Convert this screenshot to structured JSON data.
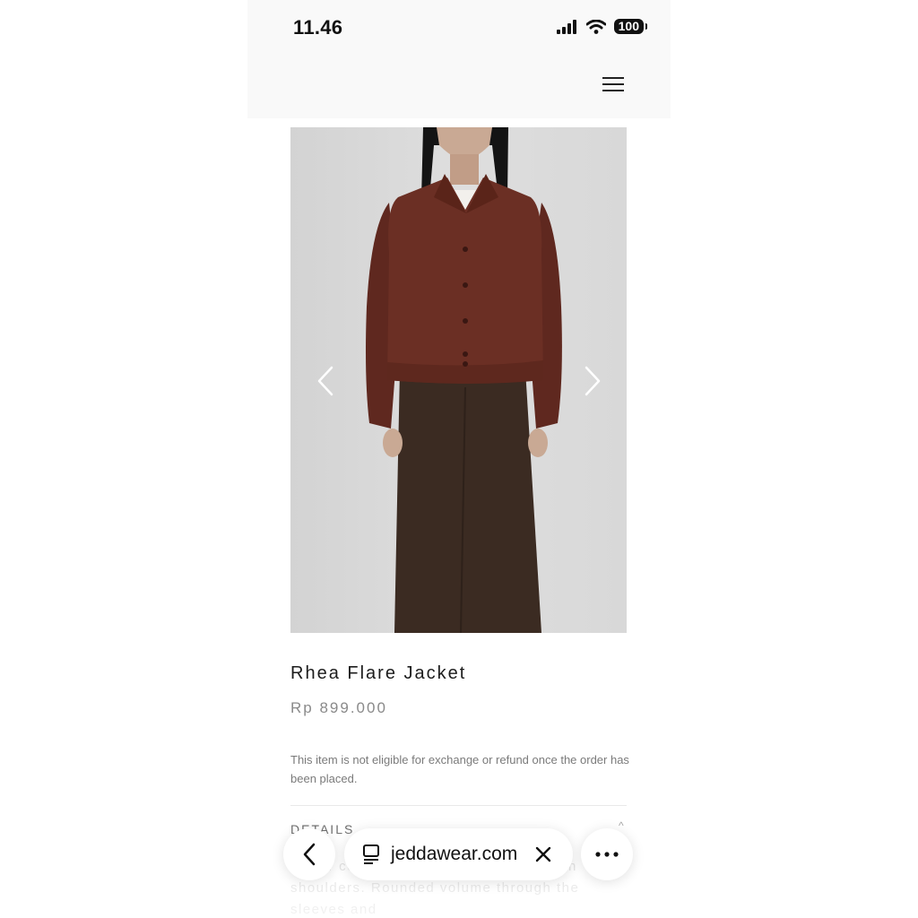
{
  "status_bar": {
    "time": "11.46",
    "battery": "100"
  },
  "product": {
    "title": "Rhea Flare Jacket",
    "price": "Rp 899.000",
    "policy_note": "This item is not eligible for exchange or refund once the order has been placed."
  },
  "details": {
    "heading": "DETAILS",
    "toggle_glyph": "^",
    "text": "…d … construction and softened raglan shoulders. Rounded volume through the sleeves and"
  },
  "browser": {
    "url": "jeddawear.com"
  },
  "icons": {
    "signal": "signal-icon",
    "wifi": "wifi-icon",
    "menu": "hamburger-menu-icon",
    "prev": "chevron-left-icon",
    "next": "chevron-right-icon",
    "tab": "tab-icon",
    "close": "close-icon",
    "more": "more-dots-icon",
    "back": "back-arrow-icon"
  },
  "colors": {
    "jacket": "#6b2f24",
    "trousers": "#3b2b22",
    "backdrop": "#d9d9d9"
  }
}
